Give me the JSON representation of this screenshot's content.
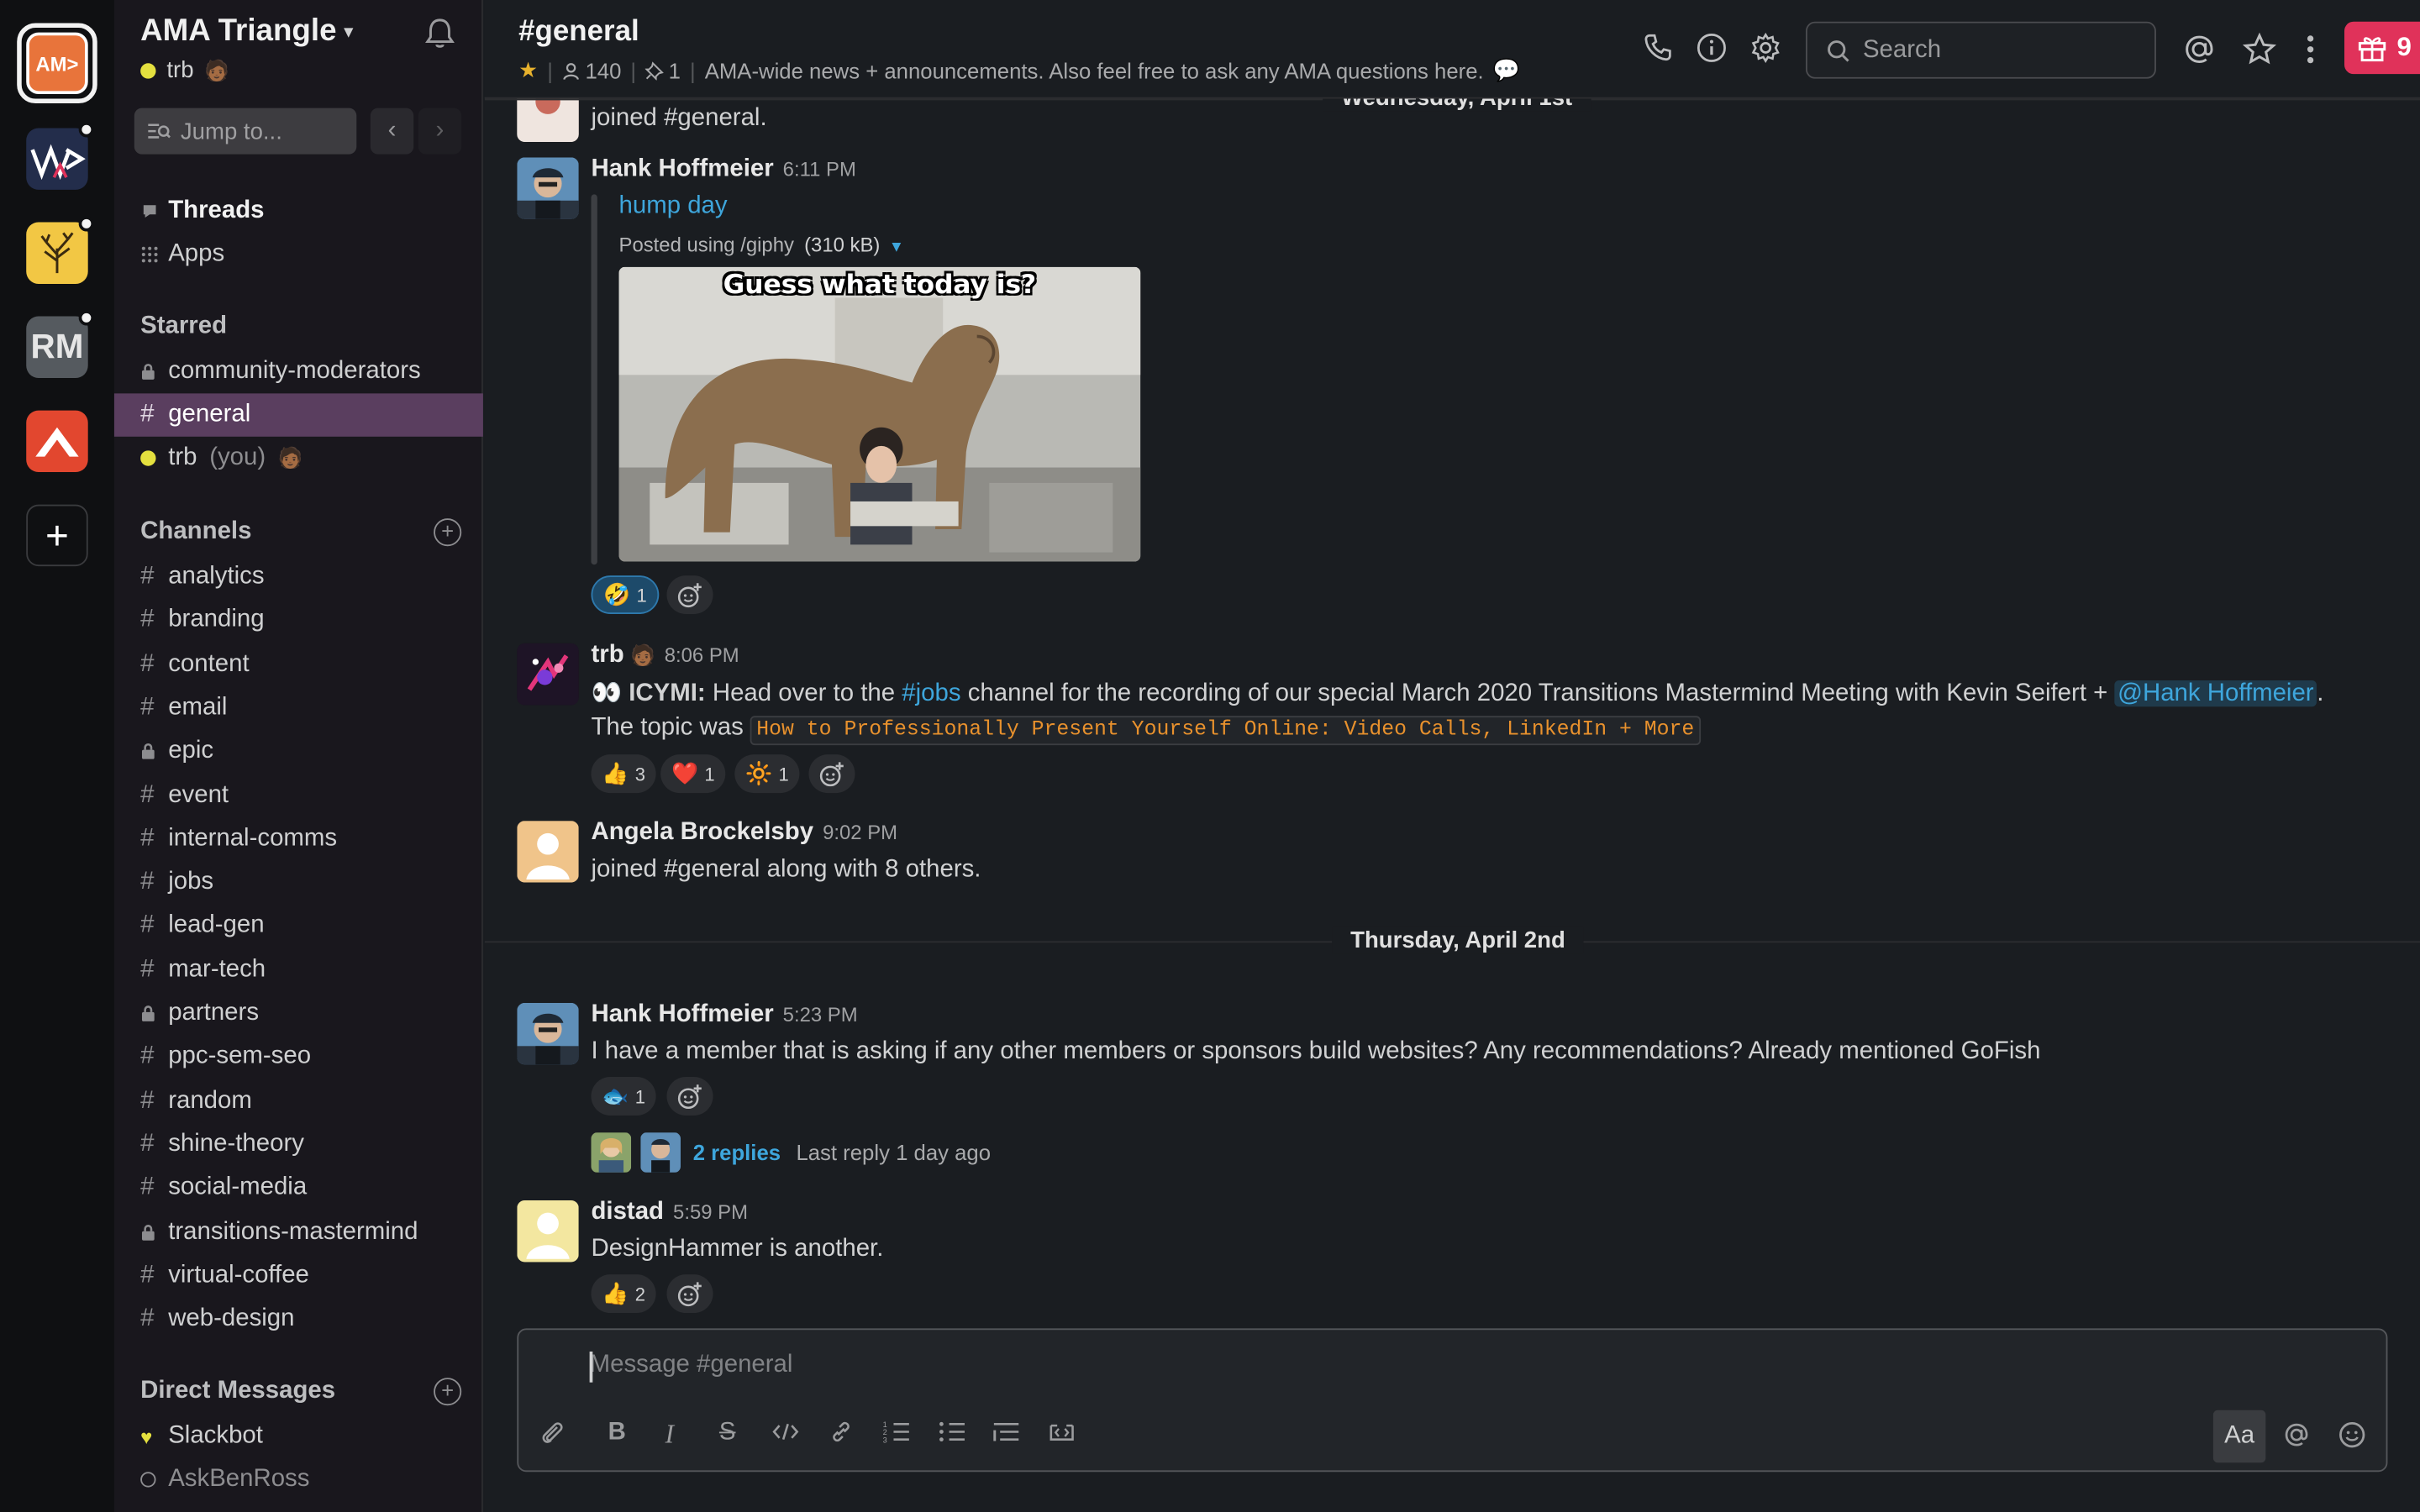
{
  "workspaces": [
    {
      "label": "AM>",
      "color": "#e8743b",
      "active": true
    },
    {
      "label": "",
      "color": "#232d4b",
      "badge": true
    },
    {
      "label": "",
      "color": "#f2c744",
      "badge": true
    },
    {
      "label": "RM",
      "color": "#555a5f",
      "badge": true
    },
    {
      "label": "",
      "color": "#e2472f"
    }
  ],
  "sidebar": {
    "team_name": "AMA Triangle",
    "user": "trb",
    "jump_placeholder": "Jump to...",
    "top_items": [
      {
        "label": "Threads"
      },
      {
        "label": "Apps"
      }
    ],
    "starred_header": "Starred",
    "starred": [
      {
        "label": "community-moderators",
        "private": true
      },
      {
        "label": "general",
        "active": true
      },
      {
        "label": "trb",
        "suffix": "(you)",
        "dm": true
      }
    ],
    "channels_header": "Channels",
    "channels": [
      {
        "label": "analytics"
      },
      {
        "label": "branding"
      },
      {
        "label": "content"
      },
      {
        "label": "email"
      },
      {
        "label": "epic",
        "private": true
      },
      {
        "label": "event"
      },
      {
        "label": "internal-comms"
      },
      {
        "label": "jobs"
      },
      {
        "label": "lead-gen"
      },
      {
        "label": "mar-tech"
      },
      {
        "label": "partners",
        "private": true
      },
      {
        "label": "ppc-sem-seo"
      },
      {
        "label": "random"
      },
      {
        "label": "shine-theory"
      },
      {
        "label": "social-media"
      },
      {
        "label": "transitions-mastermind",
        "private": true
      },
      {
        "label": "virtual-coffee"
      },
      {
        "label": "web-design"
      }
    ],
    "dm_header": "Direct Messages",
    "dms": [
      {
        "label": "Slackbot"
      },
      {
        "label": "AskBenRoss"
      }
    ]
  },
  "header": {
    "channel": "#general",
    "members": "140",
    "pins": "1",
    "topic": "AMA-wide news + announcements. Also feel free to ask any AMA questions here.",
    "search_placeholder": "Search",
    "gift_count": "9"
  },
  "messages": {
    "top_fragment": "joined #general.",
    "day1": "Wednesday, April 1st",
    "m1": {
      "author": "Hank Hoffmeier",
      "time": "6:11 PM",
      "attach_title": "hump day",
      "attach_meta": "Posted using /giphy",
      "attach_size": "(310 kB)",
      "gif_caption": "Guess what today is?",
      "reactions": [
        {
          "emoji": "🤣",
          "count": "1"
        }
      ]
    },
    "m2": {
      "author": "trb",
      "time": "8:06 PM",
      "prefix": "👀 ",
      "bold": "ICYMI:",
      "t1": " Head over to the ",
      "link": "#jobs",
      "t2": " channel for the recording of our special March 2020 Transitions Mastermind Meeting with Kevin Seifert + ",
      "mention": "@Hank Hoffmeier",
      "t3": ".",
      "line2": "The topic was ",
      "code": "How to Professionally Present Yourself Online: Video Calls, LinkedIn + More",
      "reactions": [
        {
          "emoji": "👍",
          "count": "3"
        },
        {
          "emoji": "❤️",
          "count": "1"
        },
        {
          "emoji": "🔆",
          "count": "1"
        }
      ]
    },
    "m3": {
      "author": "Angela Brockelsby",
      "time": "9:02 PM",
      "text": "joined #general along with 8 others."
    },
    "day2": "Thursday, April 2nd",
    "m4": {
      "author": "Hank Hoffmeier",
      "time": "5:23 PM",
      "text": "I have a member that is asking if any other members or sponsors build websites? Any recommendations? Already mentioned GoFish",
      "reactions": [
        {
          "emoji": "🐟",
          "count": "1"
        }
      ],
      "replies": "2 replies",
      "last_reply": "Last reply 1 day ago"
    },
    "m5": {
      "author": "distad",
      "time": "5:59 PM",
      "text": "DesignHammer is another.",
      "reactions": [
        {
          "emoji": "👍",
          "count": "2"
        }
      ]
    }
  },
  "composer": {
    "placeholder": "Message #general",
    "aa_label": "Aa"
  },
  "colors": {
    "sidebar_active": "#5a3e5f",
    "link": "#3ea6dc",
    "gift": "#e0325a",
    "presence": "#e4e03f"
  }
}
